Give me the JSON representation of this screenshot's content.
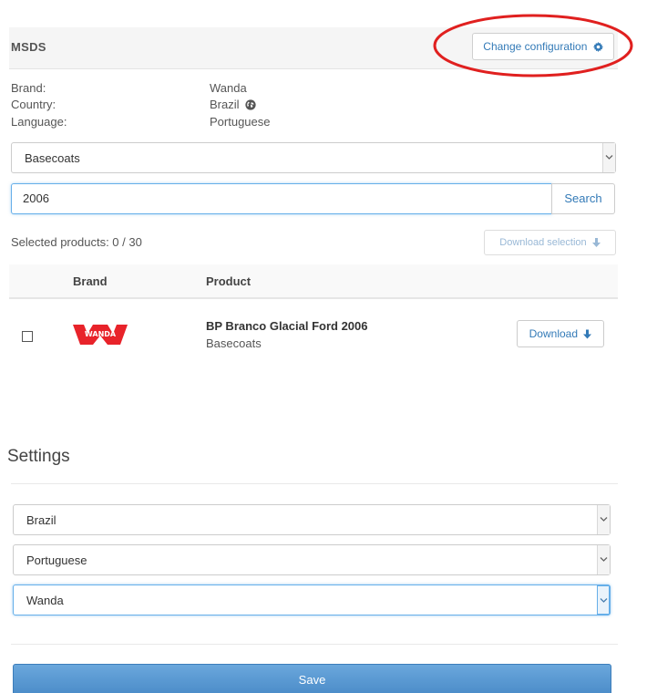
{
  "header": {
    "title": "MSDS",
    "change_config_label": "Change configuration"
  },
  "info": {
    "brand_label": "Brand:",
    "brand_value": "Wanda",
    "country_label": "Country:",
    "country_value": "Brazil",
    "language_label": "Language:",
    "language_value": "Portuguese"
  },
  "category_select": {
    "selected": "Basecoats"
  },
  "search": {
    "value": "2006",
    "button_label": "Search"
  },
  "selection": {
    "count_text": "Selected products: 0 / 30",
    "download_selection_label": "Download selection"
  },
  "table": {
    "columns": [
      "Brand",
      "Product"
    ],
    "rows": [
      {
        "brand_logo_text": "WANDA",
        "product": "BP Branco Glacial Ford 2006",
        "category": "Basecoats",
        "download_label": "Download"
      }
    ]
  },
  "settings": {
    "title": "Settings",
    "country_select": "Brazil",
    "language_select": "Portuguese",
    "brand_select": "Wanda",
    "save_label": "Save"
  },
  "colors": {
    "link_blue": "#337ab7",
    "save_blue": "#5b9bd5",
    "brand_red": "#e8232a",
    "annotation_red": "#e0201f"
  },
  "icons": {
    "config": "gear-icon",
    "country": "globe-icon",
    "download": "arrow-down-icon",
    "select": "chevron-down-icon"
  }
}
